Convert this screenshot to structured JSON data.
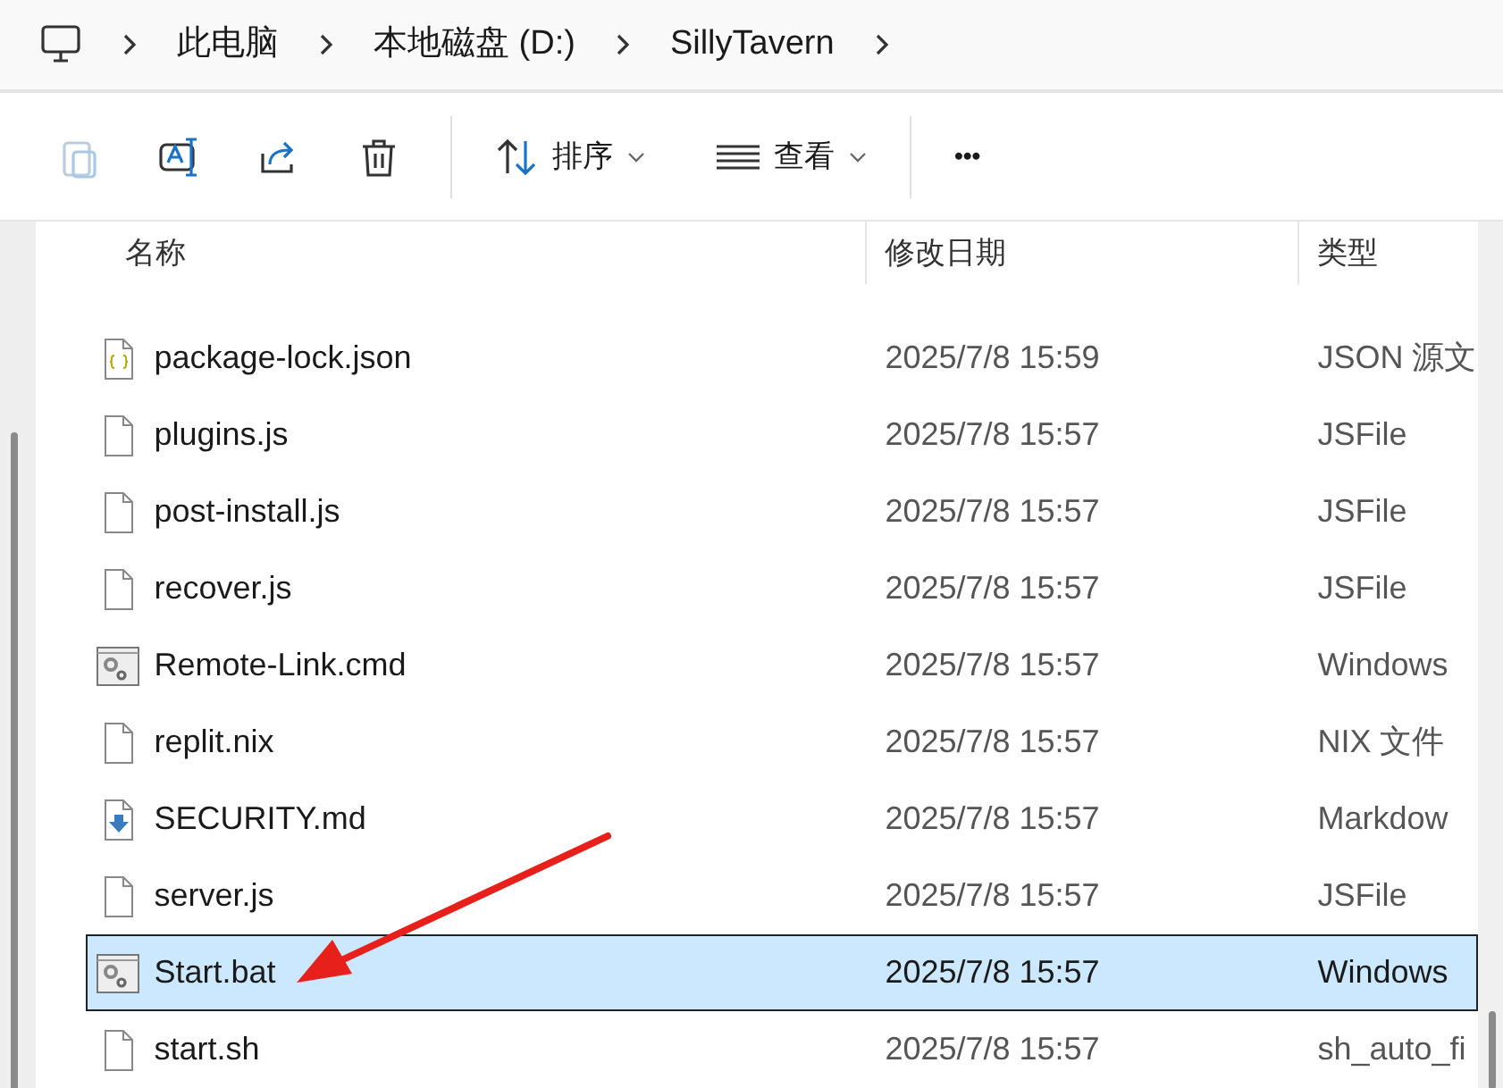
{
  "breadcrumb": [
    "此电脑",
    "本地磁盘 (D:)",
    "SillyTavern"
  ],
  "toolbar": {
    "sort": "排序",
    "view": "查看",
    "more": "•••"
  },
  "columns": [
    "名称",
    "修改日期",
    "类型"
  ],
  "rows": [
    {
      "kind": "json",
      "name": "package-lock.json",
      "date": "2025/7/8 15:59",
      "type": "JSON 源文",
      "selected": false
    },
    {
      "kind": "file",
      "name": "plugins.js",
      "date": "2025/7/8 15:57",
      "type": "JSFile",
      "selected": false
    },
    {
      "kind": "file",
      "name": "post-install.js",
      "date": "2025/7/8 15:57",
      "type": "JSFile",
      "selected": false
    },
    {
      "kind": "file",
      "name": "recover.js",
      "date": "2025/7/8 15:57",
      "type": "JSFile",
      "selected": false
    },
    {
      "kind": "cmd",
      "name": "Remote-Link.cmd",
      "date": "2025/7/8 15:57",
      "type": "Windows",
      "selected": false
    },
    {
      "kind": "file",
      "name": "replit.nix",
      "date": "2025/7/8 15:57",
      "type": "NIX 文件",
      "selected": false
    },
    {
      "kind": "md",
      "name": "SECURITY.md",
      "date": "2025/7/8 15:57",
      "type": "Markdow",
      "selected": false
    },
    {
      "kind": "file",
      "name": "server.js",
      "date": "2025/7/8 15:57",
      "type": "JSFile",
      "selected": false
    },
    {
      "kind": "cmd",
      "name": "Start.bat",
      "date": "2025/7/8 15:57",
      "type": "Windows",
      "selected": true
    },
    {
      "kind": "file",
      "name": "start.sh",
      "date": "2025/7/8 15:57",
      "type": "sh_auto_fi",
      "selected": false
    }
  ]
}
